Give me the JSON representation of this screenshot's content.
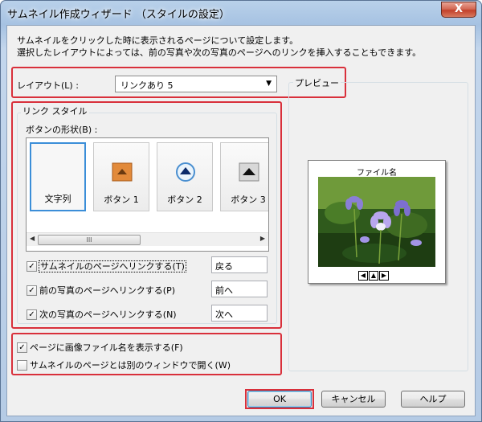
{
  "window": {
    "title": "サムネイル作成ウィザード （スタイルの設定）",
    "close_label": "X"
  },
  "description": {
    "line1": "サムネイルをクリックした時に表示されるページについて設定します。",
    "line2": "選択したレイアウトによっては、前の写真や次の写真のページへのリンクを挿入することもできます。"
  },
  "layout": {
    "label": "レイアウト(L) :",
    "value": "リンクあり 5"
  },
  "link_style": {
    "group_label": "リンク スタイル",
    "shape_label": "ボタンの形状(B) :",
    "tiles": [
      {
        "label": "文字列",
        "selected": true
      },
      {
        "label": "ボタン 1"
      },
      {
        "label": "ボタン 2"
      },
      {
        "label": "ボタン 3"
      }
    ],
    "scroll_thumb": "III",
    "checks": [
      {
        "label": "サムネイルのページへリンクする(T)",
        "checked": true,
        "text": "戻る"
      },
      {
        "label": "前の写真のページへリンクする(P)",
        "checked": true,
        "text": "前へ"
      },
      {
        "label": "次の写真のページへリンクする(N)",
        "checked": true,
        "text": "次へ"
      }
    ]
  },
  "options": [
    {
      "label": "ページに画像ファイル名を表示する(F)",
      "checked": true
    },
    {
      "label": "サムネイルのページとは別のウィンドウで開く(W)",
      "checked": false
    }
  ],
  "preview": {
    "label": "プレビュー",
    "file_name": "ファイル名"
  },
  "buttons": {
    "ok": "OK",
    "cancel": "キャンセル",
    "help": "ヘルプ"
  },
  "colors": {
    "highlight": "#d9303b",
    "selection": "#3b8ed8"
  }
}
